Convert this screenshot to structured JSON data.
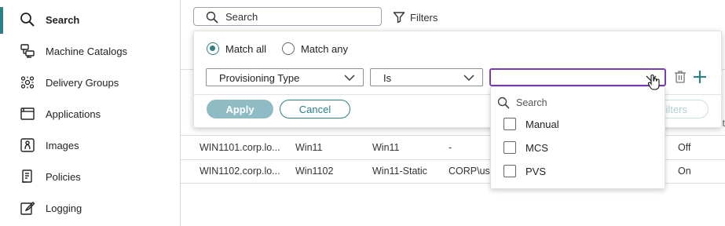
{
  "sidebar": {
    "items": [
      {
        "label": "Search",
        "icon": "search-icon",
        "active": true
      },
      {
        "label": "Machine Catalogs",
        "icon": "machine-catalog-icon"
      },
      {
        "label": "Delivery Groups",
        "icon": "delivery-groups-icon"
      },
      {
        "label": "Applications",
        "icon": "applications-icon"
      },
      {
        "label": "Images",
        "icon": "images-icon"
      },
      {
        "label": "Policies",
        "icon": "policies-icon"
      },
      {
        "label": "Logging",
        "icon": "logging-icon"
      }
    ]
  },
  "topbar": {
    "search_placeholder": "Search",
    "filters_label": "Filters"
  },
  "filter_panel": {
    "match_all": "Match all",
    "match_any": "Match any",
    "field_select": "Provisioning Type",
    "operator_select": "Is",
    "value_select": "",
    "apply": "Apply",
    "cancel": "Cancel",
    "save_filters_partial": "ilters"
  },
  "dropdown": {
    "search_placeholder": "Search",
    "options": [
      "Manual",
      "MCS",
      "PVS"
    ]
  },
  "table": {
    "header_edge_text": "t",
    "rows": [
      {
        "name": "WIN1101.corp.lo...",
        "catalog": "Win11",
        "group": "Win11",
        "user": "-",
        "power": "Off"
      },
      {
        "name": "WIN1102.corp.lo...",
        "catalog": "Win1102",
        "group": "Win11-Static",
        "user": "CORP\\use",
        "power": "On"
      }
    ]
  },
  "colors": {
    "accent": "#2e7f86",
    "focus": "#7a3db8",
    "apply_disabled": "#8fbcc4"
  }
}
